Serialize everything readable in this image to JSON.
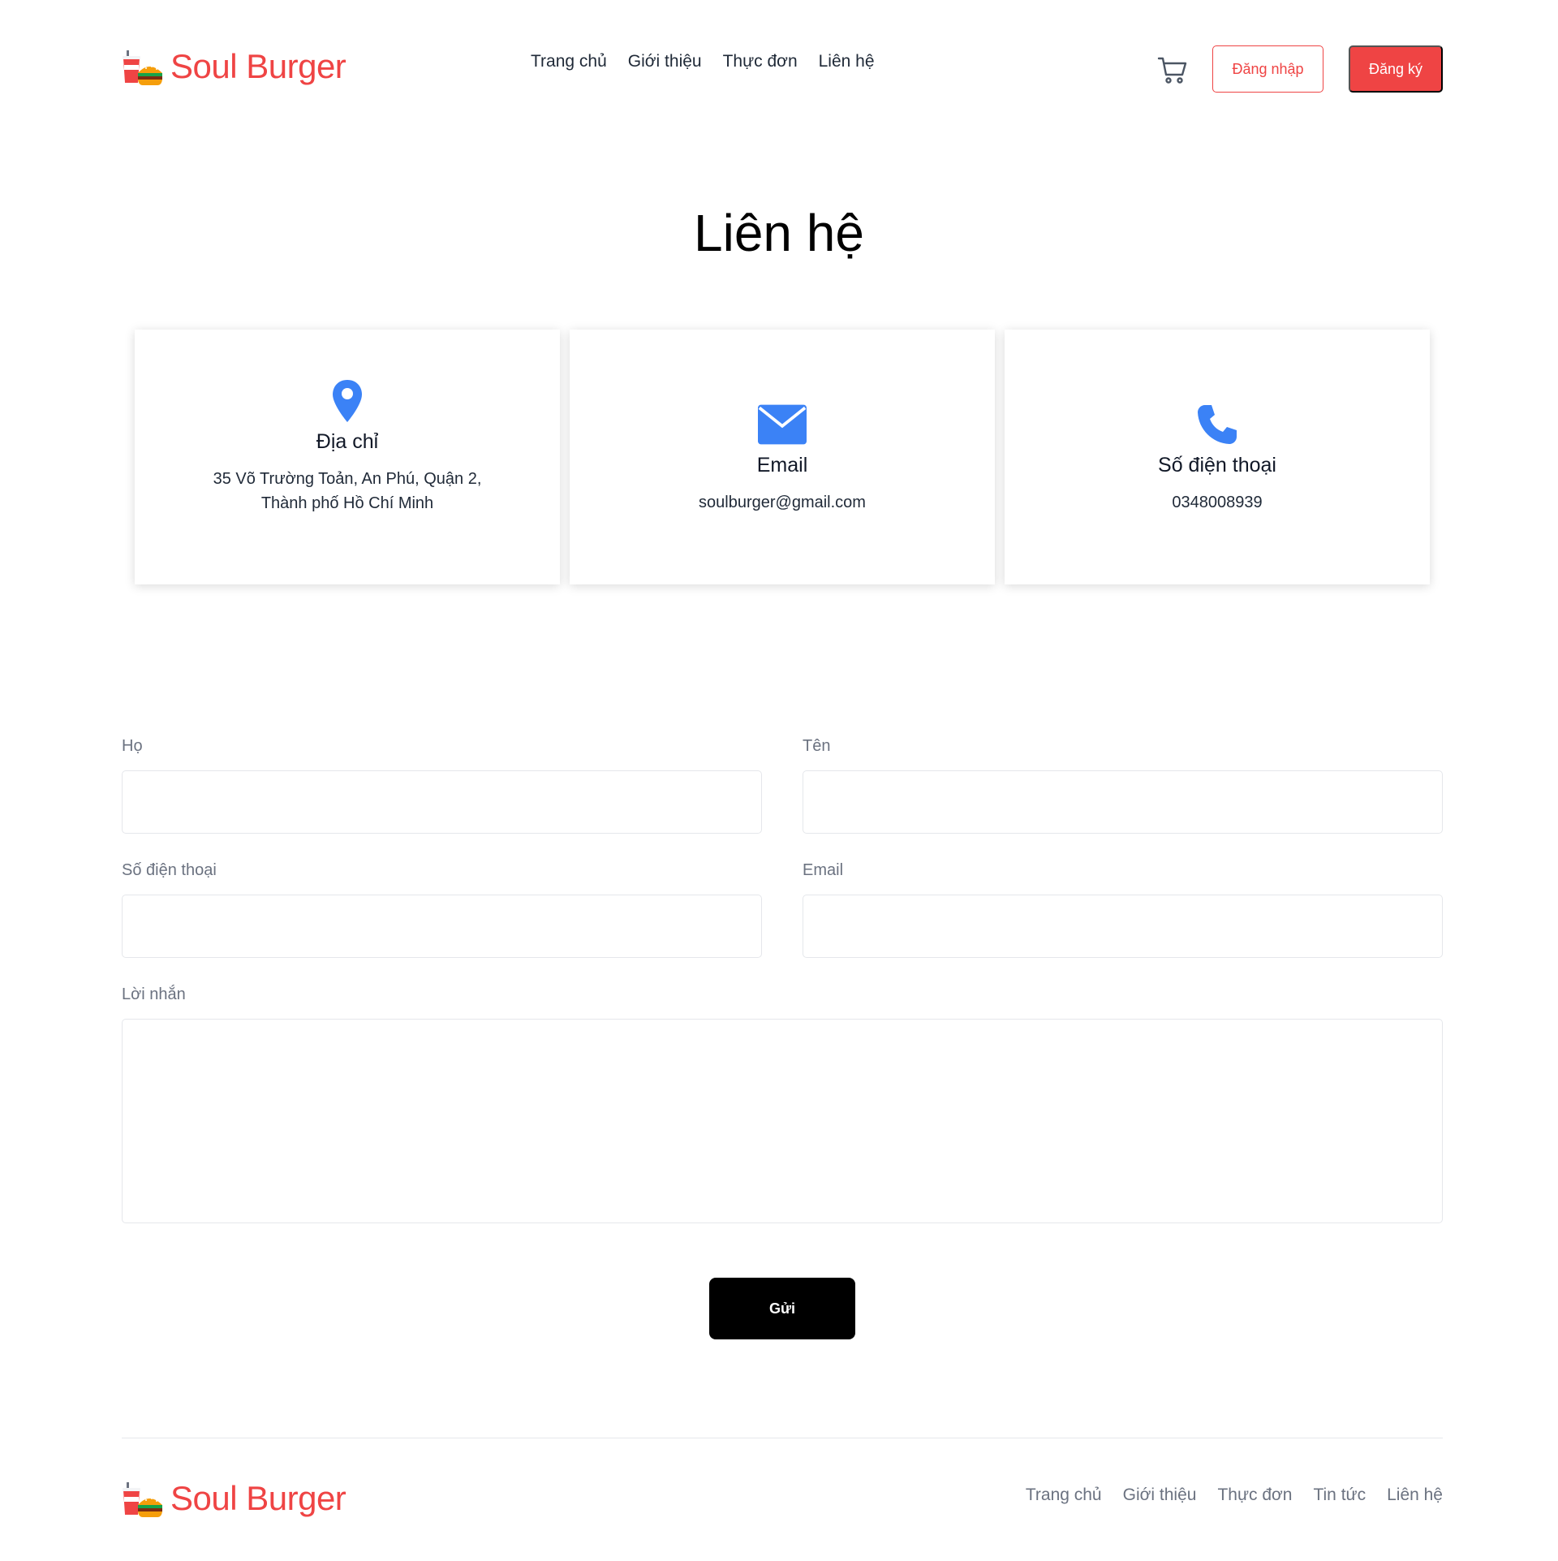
{
  "brand": {
    "name": "Soul Burger",
    "color": "#ef4444"
  },
  "header": {
    "nav": [
      "Trang chủ",
      "Giới thiệu",
      "Thực đơn",
      "Liên hệ"
    ],
    "cart_icon": "cart-icon",
    "login_label": "Đăng nhập",
    "signup_label": "Đăng ký"
  },
  "page_title": "Liên hệ",
  "cards": [
    {
      "icon": "map-pin-icon",
      "title": "Địa chỉ",
      "text": "35 Võ Trường Toản, An Phú, Quận 2, Thành phố Hồ Chí Minh"
    },
    {
      "icon": "envelope-icon",
      "title": "Email",
      "text": "soulburger@gmail.com"
    },
    {
      "icon": "phone-icon",
      "title": "Số điện thoại",
      "text": "0348008939"
    }
  ],
  "form": {
    "last_name_label": "Họ",
    "first_name_label": "Tên",
    "phone_label": "Số điện thoại",
    "email_label": "Email",
    "message_label": "Lời nhắn",
    "last_name_value": "",
    "first_name_value": "",
    "phone_value": "",
    "email_value": "",
    "message_value": "",
    "submit_label": "Gửi"
  },
  "footer": {
    "nav": [
      "Trang chủ",
      "Giới thiệu",
      "Thực đơn",
      "Tin tức",
      "Liên hệ"
    ]
  },
  "colors": {
    "accent": "#ef4444",
    "icon_blue": "#3b82f6",
    "submit_bg": "#000000"
  }
}
